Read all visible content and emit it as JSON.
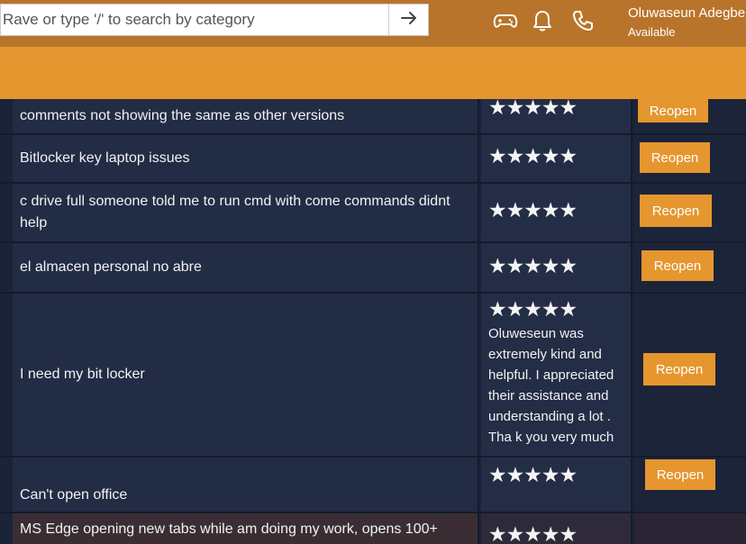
{
  "search": {
    "placeholder": "Rave or type '/' to search by category"
  },
  "header": {
    "icons": [
      "gamepad-icon",
      "bell-icon",
      "phone-icon"
    ],
    "user_name": "Oluwaseun Adegbe",
    "user_status": "Available"
  },
  "tickets": [
    {
      "title": "comments not showing the same as other versions",
      "rating": "★★★★★",
      "review": "",
      "action": "Reopen"
    },
    {
      "title": "Bitlocker key laptop issues",
      "rating": "★★★★★",
      "review": "",
      "action": "Reopen"
    },
    {
      "title": "c drive full someone told me to run cmd with come commands didnt help",
      "rating": "★★★★★",
      "review": "",
      "action": "Reopen"
    },
    {
      "title": "el almacen personal no abre",
      "rating": "★★★★★",
      "review": "",
      "action": "Reopen"
    },
    {
      "title": "I need my bit locker",
      "rating": "★★★★★",
      "review": "Oluweseun was extremely kind and helpful. I appreciated their assistance and understanding a lot . Tha k you very much",
      "action": "Reopen"
    },
    {
      "title": "Can't open office",
      "rating": "★★★★★",
      "review": "",
      "action": "Reopen"
    },
    {
      "title": "MS Edge opening new tabs while am doing my work, opens 100+",
      "rating": "★★★★★",
      "review": "",
      "action": ""
    }
  ],
  "colors": {
    "header": "#b8742a",
    "accent": "#e5962f",
    "table_bg": "#222c44"
  }
}
